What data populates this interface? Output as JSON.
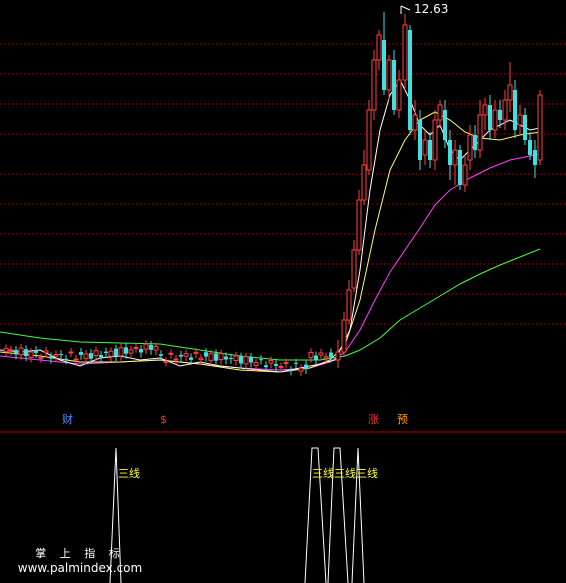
{
  "price_chart": {
    "high_label": "12.63"
  },
  "signals": [
    {
      "text": "财",
      "color": "#4a90ff"
    },
    {
      "text": "$",
      "color": "#ff3030"
    },
    {
      "text": "涨",
      "color": "#ff3030"
    },
    {
      "text": "预",
      "color": "#ff9900"
    }
  ],
  "indicator": {
    "label_1": "三线",
    "label_2": "三线三线三线"
  },
  "watermark": {
    "title": "掌 上 指 标",
    "url": "www.palmindex.com"
  },
  "colors": {
    "up_candle": "#ff4040",
    "down_candle": "#40e0e0",
    "ma_fast": "#ffffff",
    "ma_mid": "#ffff66",
    "ma_slow": "#ff40ff",
    "ma_long": "#40ff40",
    "grid": "#c00000",
    "indicator_line": "#ffffff",
    "indicator_label": "#ffff33"
  }
}
